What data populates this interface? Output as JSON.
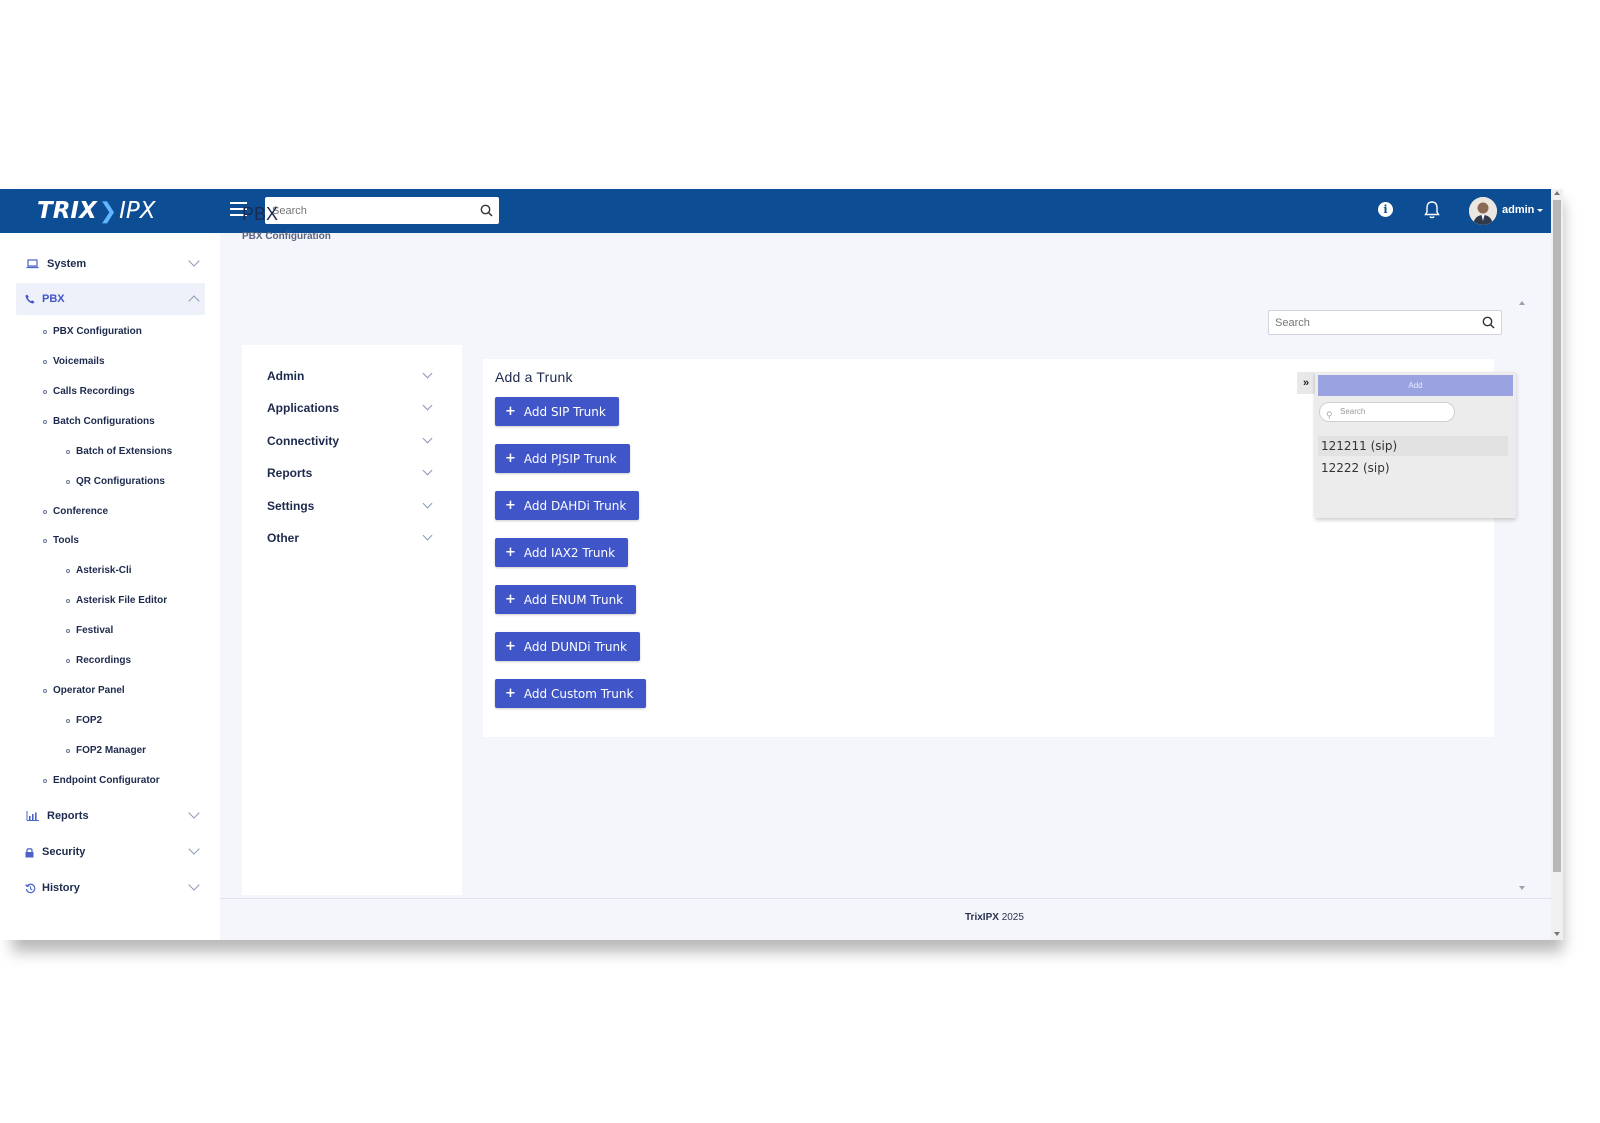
{
  "header": {
    "logo_left": "TRIX",
    "logo_right": "IPX",
    "search_placeholder": "Search",
    "user_name": "admin"
  },
  "sidebar": {
    "items": [
      {
        "label": "System",
        "icon": "laptop-icon"
      },
      {
        "label": "PBX",
        "icon": "phone-icon"
      },
      {
        "label": "Reports",
        "icon": "bar-chart-icon"
      },
      {
        "label": "Security",
        "icon": "lock-icon"
      },
      {
        "label": "History",
        "icon": "history-icon"
      }
    ],
    "pbx_sub": [
      "PBX Configuration",
      "Voicemails",
      "Calls Recordings",
      "Batch Configurations",
      "Batch of Extensions",
      "QR Configurations",
      "Conference",
      "Tools",
      "Asterisk-Cli",
      "Asterisk File Editor",
      "Festival",
      "Recordings",
      "Operator Panel",
      "FOP2",
      "FOP2 Manager",
      "Endpoint Configurator"
    ]
  },
  "page": {
    "title": "PBX",
    "subtitle": "PBX Configuration",
    "search_placeholder": "Search"
  },
  "left_menu": [
    "Admin",
    "Applications",
    "Connectivity",
    "Reports",
    "Settings",
    "Other"
  ],
  "card": {
    "title": "Add a Trunk",
    "buttons": [
      "Add SIP Trunk",
      "Add PJSIP Trunk",
      "Add DAHDi Trunk",
      "Add IAX2 Trunk",
      "Add ENUM Trunk",
      "Add DUNDi Trunk",
      "Add Custom Trunk"
    ]
  },
  "side_panel": {
    "toggle": "»",
    "add_label": "Add",
    "search_placeholder": "Search",
    "rows": [
      "121211 (sip)",
      "12222 (sip)"
    ]
  },
  "footer": {
    "brand": "TrixIPX",
    "year": "2025"
  },
  "colors": {
    "topbar": "#0d4d94",
    "button": "#3f55c8",
    "text_dark": "#1d2a4d"
  }
}
